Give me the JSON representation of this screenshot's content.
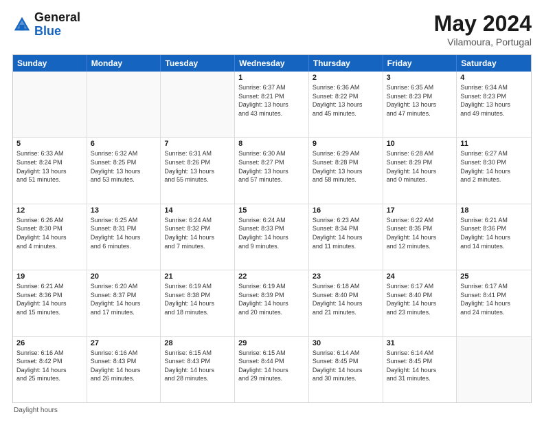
{
  "header": {
    "logo_general": "General",
    "logo_blue": "Blue",
    "month_title": "May 2024",
    "subtitle": "Vilamoura, Portugal"
  },
  "footer": {
    "note": "Daylight hours"
  },
  "days_of_week": [
    "Sunday",
    "Monday",
    "Tuesday",
    "Wednesday",
    "Thursday",
    "Friday",
    "Saturday"
  ],
  "weeks": [
    [
      {
        "day": "",
        "info": ""
      },
      {
        "day": "",
        "info": ""
      },
      {
        "day": "",
        "info": ""
      },
      {
        "day": "1",
        "info": "Sunrise: 6:37 AM\nSunset: 8:21 PM\nDaylight: 13 hours\nand 43 minutes."
      },
      {
        "day": "2",
        "info": "Sunrise: 6:36 AM\nSunset: 8:22 PM\nDaylight: 13 hours\nand 45 minutes."
      },
      {
        "day": "3",
        "info": "Sunrise: 6:35 AM\nSunset: 8:23 PM\nDaylight: 13 hours\nand 47 minutes."
      },
      {
        "day": "4",
        "info": "Sunrise: 6:34 AM\nSunset: 8:23 PM\nDaylight: 13 hours\nand 49 minutes."
      }
    ],
    [
      {
        "day": "5",
        "info": "Sunrise: 6:33 AM\nSunset: 8:24 PM\nDaylight: 13 hours\nand 51 minutes."
      },
      {
        "day": "6",
        "info": "Sunrise: 6:32 AM\nSunset: 8:25 PM\nDaylight: 13 hours\nand 53 minutes."
      },
      {
        "day": "7",
        "info": "Sunrise: 6:31 AM\nSunset: 8:26 PM\nDaylight: 13 hours\nand 55 minutes."
      },
      {
        "day": "8",
        "info": "Sunrise: 6:30 AM\nSunset: 8:27 PM\nDaylight: 13 hours\nand 57 minutes."
      },
      {
        "day": "9",
        "info": "Sunrise: 6:29 AM\nSunset: 8:28 PM\nDaylight: 13 hours\nand 58 minutes."
      },
      {
        "day": "10",
        "info": "Sunrise: 6:28 AM\nSunset: 8:29 PM\nDaylight: 14 hours\nand 0 minutes."
      },
      {
        "day": "11",
        "info": "Sunrise: 6:27 AM\nSunset: 8:30 PM\nDaylight: 14 hours\nand 2 minutes."
      }
    ],
    [
      {
        "day": "12",
        "info": "Sunrise: 6:26 AM\nSunset: 8:30 PM\nDaylight: 14 hours\nand 4 minutes."
      },
      {
        "day": "13",
        "info": "Sunrise: 6:25 AM\nSunset: 8:31 PM\nDaylight: 14 hours\nand 6 minutes."
      },
      {
        "day": "14",
        "info": "Sunrise: 6:24 AM\nSunset: 8:32 PM\nDaylight: 14 hours\nand 7 minutes."
      },
      {
        "day": "15",
        "info": "Sunrise: 6:24 AM\nSunset: 8:33 PM\nDaylight: 14 hours\nand 9 minutes."
      },
      {
        "day": "16",
        "info": "Sunrise: 6:23 AM\nSunset: 8:34 PM\nDaylight: 14 hours\nand 11 minutes."
      },
      {
        "day": "17",
        "info": "Sunrise: 6:22 AM\nSunset: 8:35 PM\nDaylight: 14 hours\nand 12 minutes."
      },
      {
        "day": "18",
        "info": "Sunrise: 6:21 AM\nSunset: 8:36 PM\nDaylight: 14 hours\nand 14 minutes."
      }
    ],
    [
      {
        "day": "19",
        "info": "Sunrise: 6:21 AM\nSunset: 8:36 PM\nDaylight: 14 hours\nand 15 minutes."
      },
      {
        "day": "20",
        "info": "Sunrise: 6:20 AM\nSunset: 8:37 PM\nDaylight: 14 hours\nand 17 minutes."
      },
      {
        "day": "21",
        "info": "Sunrise: 6:19 AM\nSunset: 8:38 PM\nDaylight: 14 hours\nand 18 minutes."
      },
      {
        "day": "22",
        "info": "Sunrise: 6:19 AM\nSunset: 8:39 PM\nDaylight: 14 hours\nand 20 minutes."
      },
      {
        "day": "23",
        "info": "Sunrise: 6:18 AM\nSunset: 8:40 PM\nDaylight: 14 hours\nand 21 minutes."
      },
      {
        "day": "24",
        "info": "Sunrise: 6:17 AM\nSunset: 8:40 PM\nDaylight: 14 hours\nand 23 minutes."
      },
      {
        "day": "25",
        "info": "Sunrise: 6:17 AM\nSunset: 8:41 PM\nDaylight: 14 hours\nand 24 minutes."
      }
    ],
    [
      {
        "day": "26",
        "info": "Sunrise: 6:16 AM\nSunset: 8:42 PM\nDaylight: 14 hours\nand 25 minutes."
      },
      {
        "day": "27",
        "info": "Sunrise: 6:16 AM\nSunset: 8:43 PM\nDaylight: 14 hours\nand 26 minutes."
      },
      {
        "day": "28",
        "info": "Sunrise: 6:15 AM\nSunset: 8:43 PM\nDaylight: 14 hours\nand 28 minutes."
      },
      {
        "day": "29",
        "info": "Sunrise: 6:15 AM\nSunset: 8:44 PM\nDaylight: 14 hours\nand 29 minutes."
      },
      {
        "day": "30",
        "info": "Sunrise: 6:14 AM\nSunset: 8:45 PM\nDaylight: 14 hours\nand 30 minutes."
      },
      {
        "day": "31",
        "info": "Sunrise: 6:14 AM\nSunset: 8:45 PM\nDaylight: 14 hours\nand 31 minutes."
      },
      {
        "day": "",
        "info": ""
      }
    ]
  ]
}
